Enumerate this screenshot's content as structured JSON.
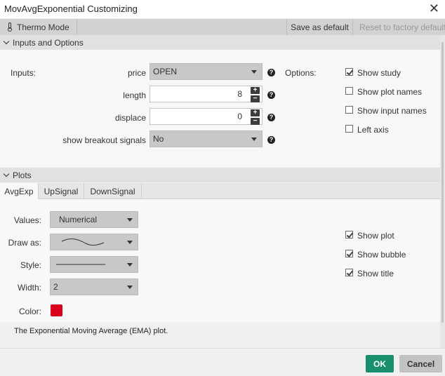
{
  "window": {
    "title": "MovAvgExponential Customizing",
    "close_symbol": "✕"
  },
  "toolbar": {
    "thermo_label": "Thermo Mode",
    "save_default_label": "Save as default",
    "reset_default_label": "Reset to factory default"
  },
  "inputs_section": {
    "header": "Inputs and Options",
    "inputs_label": "Inputs:",
    "options_label": "Options:",
    "fields": {
      "price": {
        "label": "price",
        "value": "OPEN"
      },
      "length": {
        "label": "length",
        "value": "8"
      },
      "displace": {
        "label": "displace",
        "value": "0"
      },
      "breakout": {
        "label": "show breakout signals",
        "value": "No"
      }
    },
    "options": [
      {
        "label": "Show study",
        "checked": true
      },
      {
        "label": "Show plot names",
        "checked": false
      },
      {
        "label": "Show input names",
        "checked": false
      },
      {
        "label": "Left axis",
        "checked": false
      }
    ],
    "help_symbol": "?",
    "stepper_plus": "+",
    "stepper_minus": "−"
  },
  "plots_section": {
    "header": "Plots",
    "tabs": [
      "AvgExp",
      "UpSignal",
      "DownSignal"
    ],
    "active_tab": "AvgExp",
    "values_label": "Values:",
    "values_value": "Numerical",
    "draw_as_label": "Draw as:",
    "style_label": "Style:",
    "width_label": "Width:",
    "width_value": "2",
    "color_label": "Color:",
    "color_hex": "#d9001b",
    "options": [
      {
        "label": "Show plot",
        "checked": true
      },
      {
        "label": "Show bubble",
        "checked": true
      },
      {
        "label": "Show title",
        "checked": true
      }
    ],
    "description": "The Exponential Moving Average (EMA) plot."
  },
  "footer": {
    "ok_label": "OK",
    "cancel_label": "Cancel"
  },
  "colors": {
    "ok_button": "#1a8f6d",
    "cancel_button": "#c3c3c3",
    "plot_color": "#d9001b"
  },
  "icons": {
    "thermo": "thermometer-icon",
    "help": "help-icon",
    "chevron": "chevron-down-icon"
  }
}
